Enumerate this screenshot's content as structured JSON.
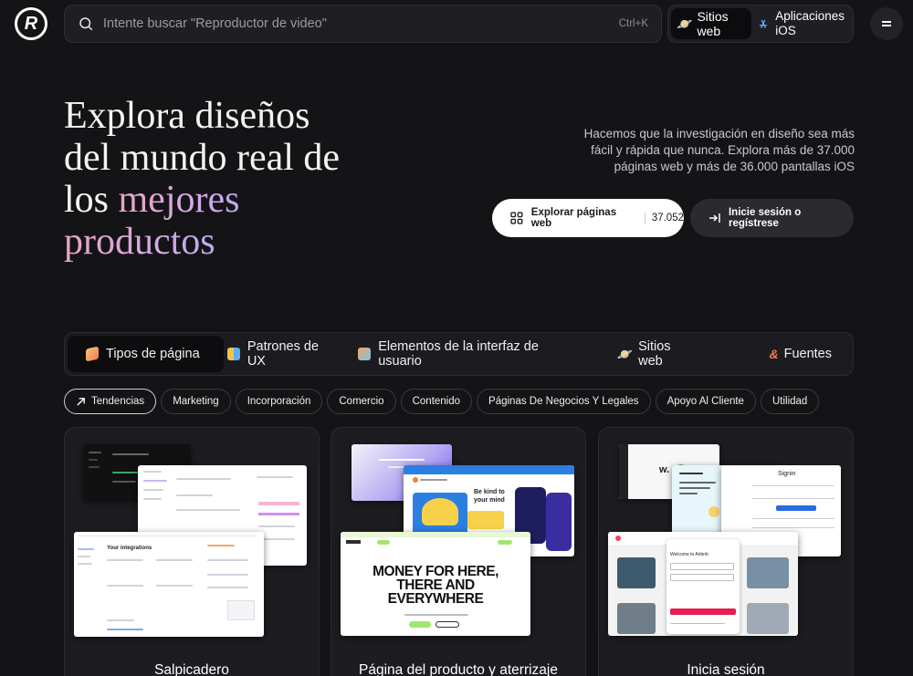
{
  "header": {
    "search_placeholder": "Intente buscar \"Reproductor de video\"",
    "search_shortcut": "Ctrl+K",
    "platforms": [
      {
        "label": "Sitios web",
        "emoji": "🪐",
        "active": true
      },
      {
        "label_line1": "Aplicaciones",
        "label_line2": "iOS",
        "active": false
      }
    ]
  },
  "hero": {
    "title_line1": "Explora diseños",
    "title_line2": "del mundo real de",
    "title_line3_plain": "los ",
    "title_line3_grad": "mejores",
    "title_line4_grad": "productos",
    "description": "Hacemos que la investigación en diseño sea más fácil y rápida que nunca. Explora más de 37.000 páginas web y más de 36.000 pantallas iOS",
    "cta_primary_label": "Explorar páginas web",
    "cta_primary_count": "37.052",
    "cta_secondary_label": "Inicie sesión o regístrese"
  },
  "categories": [
    {
      "label": "Tipos de página",
      "active": true,
      "color": "#f2a15c"
    },
    {
      "label": "Patrones de UX",
      "active": false,
      "color": "#f0b640"
    },
    {
      "label": "Elementos de la interfaz de usuario",
      "active": false,
      "color": "#6fb6f2"
    },
    {
      "label": "Sitios web",
      "active": false,
      "color": "#b48af0"
    },
    {
      "label": "Fuentes",
      "active": false,
      "color": "#f07a4a"
    }
  ],
  "chips": [
    {
      "label": "Tendencias",
      "active": true
    },
    {
      "label": "Marketing"
    },
    {
      "label": "Incorporación"
    },
    {
      "label": "Comercio"
    },
    {
      "label": "Contenido"
    },
    {
      "label": "Páginas De Negocios Y Legales"
    },
    {
      "label": "Apoyo Al Cliente"
    },
    {
      "label": "Utilidad"
    }
  ],
  "cards": [
    {
      "label": "Salpicadero",
      "shot_text": [
        "Your integrations"
      ]
    },
    {
      "label": "Página del producto y aterrizaje",
      "shot_text": [
        "MONEY FOR HERE,",
        "THERE AND",
        "EVERYWHERE",
        "Be kind to",
        "your mind"
      ]
    },
    {
      "label": "Inicia sesión",
      "shot_text": [
        "Signin",
        "Welcome to Airbnb"
      ]
    }
  ]
}
